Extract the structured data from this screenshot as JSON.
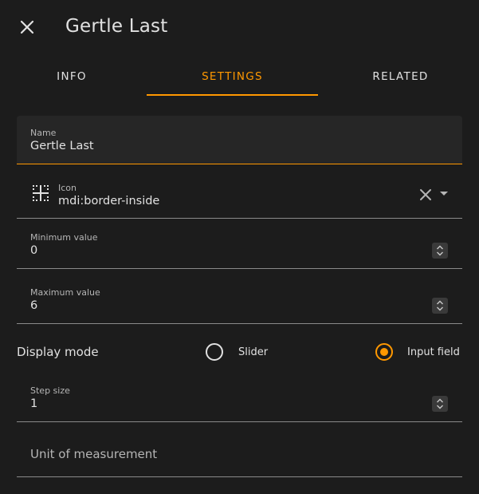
{
  "dialog": {
    "title": "Gertle Last",
    "close_icon": "close-icon"
  },
  "tabs": [
    {
      "label": "INFO",
      "active": false
    },
    {
      "label": "SETTINGS",
      "active": true
    },
    {
      "label": "RELATED",
      "active": false
    }
  ],
  "form": {
    "name": {
      "label": "Name",
      "value": "Gertle Last"
    },
    "icon": {
      "label": "Icon",
      "value": "mdi:border-inside",
      "icon": "border-inside-icon"
    },
    "minimum": {
      "label": "Minimum value",
      "value": "0"
    },
    "maximum": {
      "label": "Maximum value",
      "value": "6"
    },
    "display_mode": {
      "label": "Display mode",
      "options": [
        {
          "label": "Slider",
          "selected": false
        },
        {
          "label": "Input field",
          "selected": true
        }
      ]
    },
    "step": {
      "label": "Step size",
      "value": "1"
    },
    "unit": {
      "placeholder": "Unit of measurement",
      "value": ""
    }
  },
  "colors": {
    "accent": "#ff9800",
    "background": "#1c1c1c",
    "text": "#e1e1e1",
    "secondary_text": "#b5b5b5"
  }
}
